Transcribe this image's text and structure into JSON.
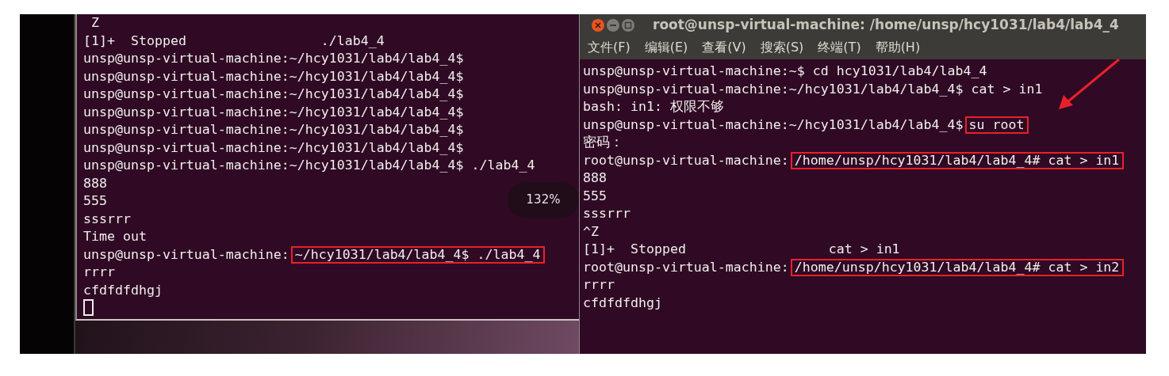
{
  "left_terminal": {
    "lines": [
      [
        {
          "text": " Z"
        }
      ],
      [
        {
          "text": "[1]+  Stopped                 ./lab4_4"
        }
      ],
      [
        {
          "text": "unsp@unsp-virtual-machine:~/hcy1031/lab4/lab4_4$"
        }
      ],
      [
        {
          "text": "unsp@unsp-virtual-machine:~/hcy1031/lab4/lab4_4$"
        }
      ],
      [
        {
          "text": "unsp@unsp-virtual-machine:~/hcy1031/lab4/lab4_4$"
        }
      ],
      [
        {
          "text": "unsp@unsp-virtual-machine:~/hcy1031/lab4/lab4_4$"
        }
      ],
      [
        {
          "text": "unsp@unsp-virtual-machine:~/hcy1031/lab4/lab4_4$"
        }
      ],
      [
        {
          "text": "unsp@unsp-virtual-machine:~/hcy1031/lab4/lab4_4$"
        }
      ],
      [
        {
          "text": "unsp@unsp-virtual-machine:~/hcy1031/lab4/lab4_4$ ./lab4_4"
        }
      ],
      [
        {
          "text": "888"
        }
      ],
      [
        {
          "text": "555"
        }
      ],
      [
        {
          "text": "sssrrr"
        }
      ],
      [
        {
          "text": "Time out"
        }
      ],
      [
        {
          "text": "unsp@unsp-virtual-machine:"
        },
        {
          "text": "~/hcy1031/lab4/lab4_4$ ./lab4_4",
          "boxed": true
        }
      ],
      [
        {
          "text": "rrrr"
        }
      ],
      [
        {
          "text": "cfdfdfdhgj"
        }
      ]
    ]
  },
  "zoom_indicator": "132%",
  "right_terminal": {
    "title": "root@unsp-virtual-machine: /home/unsp/hcy1031/lab4/lab4_4",
    "menu": [
      "文件(F)",
      "编辑(E)",
      "查看(V)",
      "搜索(S)",
      "终端(T)",
      "帮助(H)"
    ],
    "lines": [
      [
        {
          "text": "unsp@unsp-virtual-machine:~$ cd hcy1031/lab4/lab4_4"
        }
      ],
      [
        {
          "text": "unsp@unsp-virtual-machine:~/hcy1031/lab4/lab4_4$ cat > in1"
        }
      ],
      [
        {
          "text": "bash: in1: 权限不够"
        }
      ],
      [
        {
          "text": "unsp@unsp-virtual-machine:~/hcy1031/lab4/lab4_4$"
        },
        {
          "text": "su root",
          "boxed": true
        }
      ],
      [
        {
          "text": "密码："
        }
      ],
      [
        {
          "text": "root@unsp-virtual-machine:"
        },
        {
          "text": "/home/unsp/hcy1031/lab4/lab4_4# cat > in1",
          "boxed": true
        }
      ],
      [
        {
          "text": "888"
        }
      ],
      [
        {
          "text": "555"
        }
      ],
      [
        {
          "text": "sssrrr"
        }
      ],
      [
        {
          "text": "^Z"
        }
      ],
      [
        {
          "text": "[1]+  Stopped                  cat > in1"
        }
      ],
      [
        {
          "text": "root@unsp-virtual-machine:"
        },
        {
          "text": "/home/unsp/hcy1031/lab4/lab4_4# cat > in2",
          "boxed": true
        }
      ],
      [
        {
          "text": "rrrr"
        }
      ],
      [
        {
          "text": "cfdfdfdhgj"
        }
      ]
    ]
  }
}
